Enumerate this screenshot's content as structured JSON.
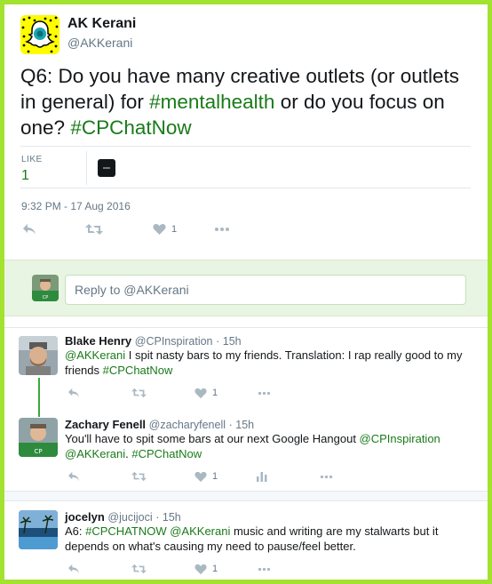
{
  "tweet": {
    "name": "AK Kerani",
    "handle": "@AKKerani",
    "text_parts": {
      "p1": "Q6: Do you have many creative outlets (or outlets in general) for ",
      "tag1": "#mentalhealth",
      "p2": " or do you focus on one? ",
      "tag2": "#CPChatNow"
    },
    "likes_label": "LIKE",
    "likes_count": "1",
    "timestamp": "9:32 PM - 17 Aug 2016",
    "like_action_count": "1"
  },
  "reply_box": {
    "placeholder": "Reply to @AKKerani"
  },
  "replies": [
    {
      "name": "Blake Henry",
      "handle": "@CPInspiration",
      "time": "15h",
      "mention": "@AKKerani",
      "text": " I spit nasty bars to my friends. Translation: I rap really good to my friends ",
      "tag": "#CPChatNow",
      "like_count": "1"
    },
    {
      "name": "Zachary Fenell",
      "handle": "@zacharyfenell",
      "time": "15h",
      "text": "You'll have to spit some bars at our next Google Hangout ",
      "mention1": "@CPInspiration",
      "mention2": "@AKKerani",
      "text2": ". ",
      "tag": "#CPChatNow",
      "like_count": "1"
    },
    {
      "name": "jocelyn",
      "handle": "@jucijoci",
      "time": "15h",
      "text1": "A6: ",
      "tag": "#CPCHATNOW",
      "mention": "@AKKerani",
      "text2": " music and writing are my stalwarts but it depends on what's causing my need to pause/feel better.",
      "like_count": "1"
    }
  ],
  "colors": {
    "frame": "#a3e22f",
    "link": "#1a7a1a",
    "muted": "#657786",
    "icon": "#aab8c2"
  },
  "icons": [
    "snapchat-ghost-icon",
    "reply-icon",
    "retweet-icon",
    "heart-icon",
    "more-icon",
    "analytics-icon"
  ]
}
